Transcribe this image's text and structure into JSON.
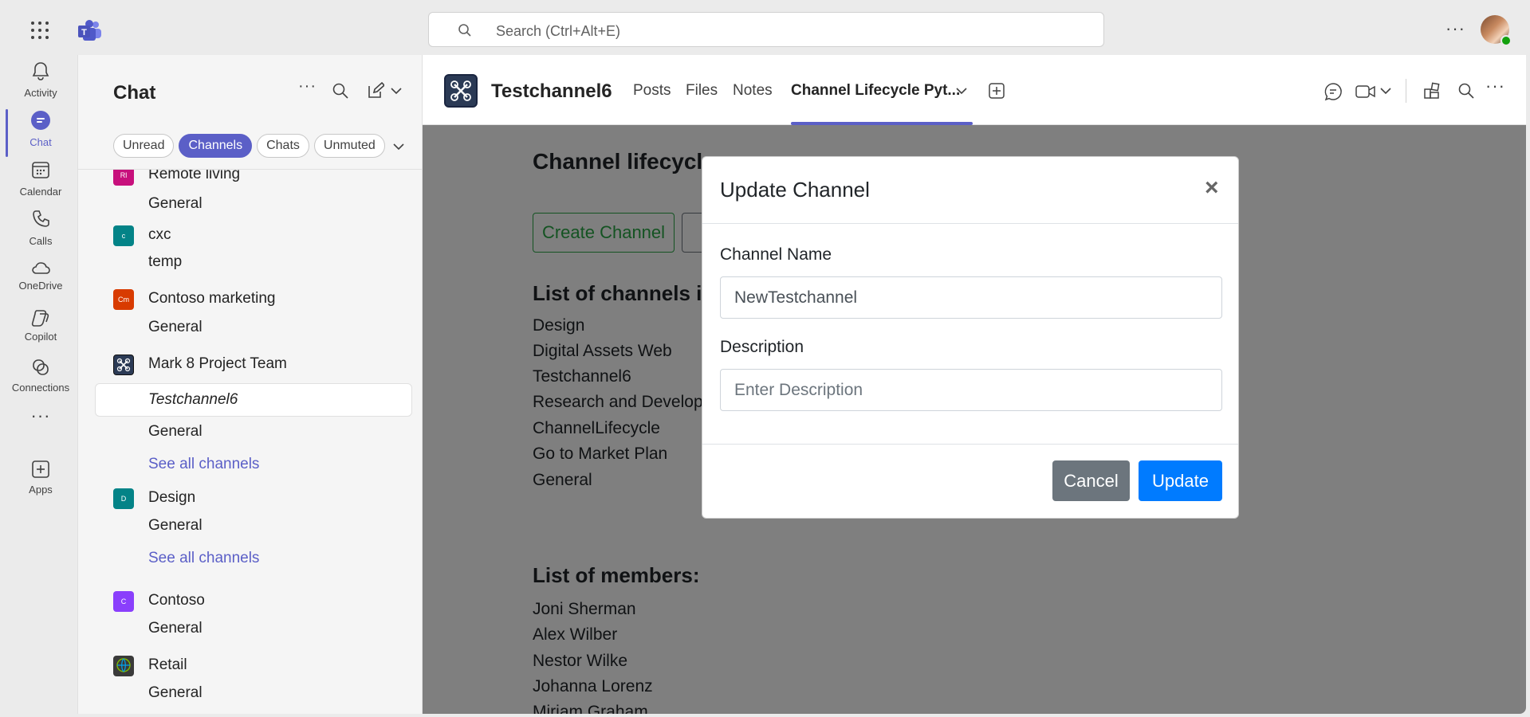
{
  "search": {
    "placeholder": "Search (Ctrl+Alt+E)"
  },
  "rail": [
    {
      "label": "Activity",
      "icon": "bell-icon"
    },
    {
      "label": "Chat",
      "icon": "chat-icon"
    },
    {
      "label": "Calendar",
      "icon": "calendar-icon"
    },
    {
      "label": "Calls",
      "icon": "phone-icon"
    },
    {
      "label": "OneDrive",
      "icon": "cloud-icon"
    },
    {
      "label": "Copilot",
      "icon": "copilot-icon"
    },
    {
      "label": "Connections",
      "icon": "connections-icon"
    },
    {
      "label": "Apps",
      "icon": "apps-icon"
    }
  ],
  "panel": {
    "title": "Chat",
    "filters": [
      "Unread",
      "Channels",
      "Chats",
      "Unmuted"
    ],
    "teams": [
      {
        "name": "Remote living",
        "initials": "Rl",
        "color": "#c7107c",
        "channels": [
          "General"
        ]
      },
      {
        "name": "cxc",
        "initials": "c",
        "color": "#038387",
        "channels": [
          "temp"
        ]
      },
      {
        "name": "Contoso marketing",
        "initials": "Cm",
        "color": "#d83b01",
        "channels": [
          "General"
        ]
      },
      {
        "name": "Mark 8 Project Team",
        "initials": "",
        "color": "#2b3a55",
        "selected_channel": "Testchannel6",
        "channels": [
          "General",
          "See all channels"
        ]
      },
      {
        "name": "Design",
        "initials": "D",
        "color": "#038387",
        "channels": [
          "General",
          "See all channels"
        ]
      },
      {
        "name": "Contoso",
        "initials": "C",
        "color": "#8a3ffc",
        "channels": [
          "General"
        ]
      },
      {
        "name": "Retail",
        "initials": "",
        "color": "#3a3a3a",
        "channels": [
          "General"
        ]
      }
    ]
  },
  "header": {
    "channel_name": "Testchannel6",
    "tabs": [
      "Posts",
      "Files",
      "Notes",
      "Channel Lifecycle Pyt..."
    ]
  },
  "content": {
    "title": "Channel lifecycle",
    "create_button": "Create Channel",
    "channels_heading": "List of channels in",
    "channels": [
      "Design",
      "Digital Assets Web",
      "Testchannel6",
      "Research and Develop",
      "ChannelLifecycle",
      "Go to Market Plan",
      "General"
    ],
    "members_heading": "List of members:",
    "members": [
      "Joni Sherman",
      "Alex Wilber",
      "Nestor Wilke",
      "Johanna Lorenz",
      "Miriam Graham"
    ]
  },
  "modal": {
    "title": "Update Channel",
    "close": "×",
    "name_label": "Channel Name",
    "name_value": "NewTestchannel",
    "desc_label": "Description",
    "desc_placeholder": "Enter Description",
    "cancel": "Cancel",
    "update": "Update"
  }
}
